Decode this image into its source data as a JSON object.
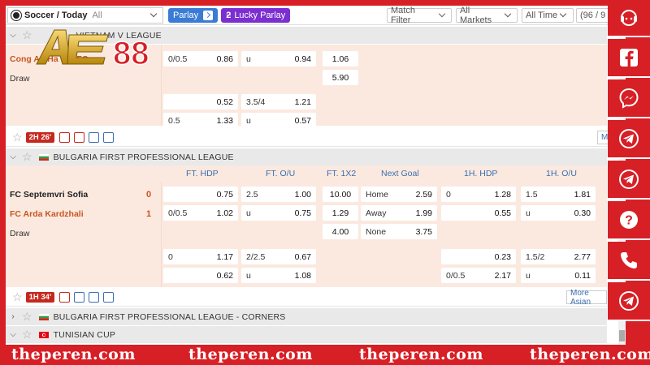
{
  "topbar": {
    "sport_title": "Soccer / Today",
    "sport_filter": "All",
    "parlay": "Parlay",
    "lucky_parlay": "Lucky Parlay",
    "match_filter": "Match Filter",
    "all_markets": "All Markets",
    "all_time": "All Time",
    "count": "(96 / 9"
  },
  "logo_text": "AE88",
  "leagues": {
    "vietnam": "VIETNAM V LEAGUE",
    "bulgaria": "BULGARIA FIRST PROFESSIONAL LEAGUE",
    "bulgaria_corners": "BULGARIA FIRST PROFESSIONAL LEAGUE - CORNERS",
    "tunisian": "TUNISIAN CUP"
  },
  "match1": {
    "home": "Cong An Ha Noi FC",
    "draw": "Draw",
    "status_time": "2H 26'",
    "more": "M",
    "rows": [
      {
        "hdp_line": "0/0.5",
        "hdp_odd": "0.86",
        "ou_label": "u",
        "ou_odd": "0.94",
        "x12": "1.06"
      },
      {
        "x12": "5.90"
      },
      {
        "hdp_odd": "0.52",
        "ou_line": "3.5/4",
        "ou_odd": "1.21"
      },
      {
        "hdp_line": "0.5",
        "hdp_odd": "1.33",
        "ou_label": "u",
        "ou_odd": "0.57"
      }
    ]
  },
  "columns": {
    "ft_hdp": "FT. HDP",
    "ft_ou": "FT. O/U",
    "ft_1x2": "FT. 1X2",
    "next_goal": "Next Goal",
    "h1_hdp": "1H. HDP",
    "h1_ou": "1H. O/U"
  },
  "match2": {
    "home": "FC Septemvri Sofia",
    "away": "FC Arda Kardzhali",
    "draw": "Draw",
    "home_score": "0",
    "away_score": "1",
    "status_time": "1H 34'",
    "more": "More Asian",
    "r1": {
      "hdp_odd": "0.75",
      "ou_line": "2.5",
      "ou_odd": "1.00",
      "x12": "10.00",
      "ng_label": "Home",
      "ng_odd": "2.59",
      "h1_line": "0",
      "h1_odd": "1.28",
      "h1ou_line": "1.5",
      "h1ou_odd": "1.81"
    },
    "r2": {
      "hdp_line": "0/0.5",
      "hdp_odd": "1.02",
      "ou_label": "u",
      "ou_odd": "0.75",
      "x12": "1.29",
      "ng_label": "Away",
      "ng_odd": "1.99",
      "h1_odd": "0.55",
      "h1ou_label": "u",
      "h1ou_odd": "0.30"
    },
    "r3": {
      "x12": "4.00",
      "ng_label": "None",
      "ng_odd": "3.75"
    },
    "r4": {
      "hdp_line": "0",
      "hdp_odd": "1.17",
      "ou_line": "2/2.5",
      "ou_odd": "0.67",
      "h1_odd": "0.23",
      "h1ou_line": "1.5/2",
      "h1ou_odd": "2.77"
    },
    "r5": {
      "hdp_odd": "0.62",
      "ou_label": "u",
      "ou_odd": "1.08",
      "h1_line": "0/0.5",
      "h1_odd": "2.17",
      "h1ou_label": "u",
      "h1ou_odd": "0.11"
    }
  },
  "social": [
    "chat-support",
    "facebook",
    "messenger",
    "telegram",
    "telegram",
    "help",
    "phone",
    "telegram"
  ],
  "watermark": "theperen.com",
  "colors": {
    "frame": "#d71f26",
    "odds_bg": "#fbe9e0",
    "accent_blue": "#3b6fb0",
    "orange": "#c9561d"
  }
}
